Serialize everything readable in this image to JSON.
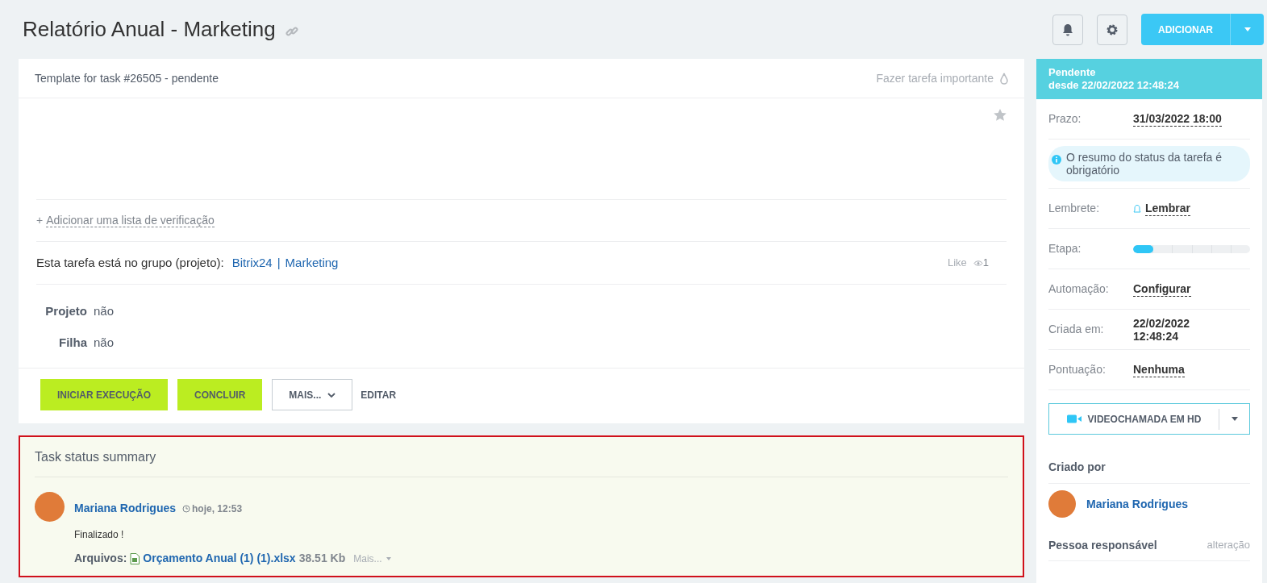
{
  "header": {
    "title": "Relatório Anual - Marketing",
    "add_button": "ADICIONAR"
  },
  "task": {
    "subtitle": "Template for task #26505 - pendente",
    "important_label": "Fazer tarefa importante",
    "checklist_plus": "+",
    "checklist_link": "Adicionar uma lista de verificação",
    "group_label": "Esta tarefa está no grupo (projeto):",
    "group_links": [
      "Bitrix24",
      "Marketing"
    ],
    "group_separator": "|",
    "like": "Like",
    "views": "1",
    "fields": [
      {
        "label": "Projeto",
        "value": "não"
      },
      {
        "label": "Filha",
        "value": "não"
      }
    ],
    "actions": [
      {
        "label": "INICIAR EXECUÇÃO",
        "kind": "primary"
      },
      {
        "label": "CONCLUIR",
        "kind": "primary"
      },
      {
        "label": "MAIS...",
        "kind": "dropdown"
      },
      {
        "label": "EDITAR",
        "kind": "link"
      }
    ]
  },
  "summary": {
    "title": "Task status summary",
    "author": "Mariana Rodrigues",
    "time": "hoje, 12:53",
    "text": "Finalizado !",
    "files_label": "Arquivos:",
    "file_name": "Orçamento Anual (1) (1).xlsx",
    "file_size": "38.51 Kb",
    "more": "Mais..."
  },
  "sidebar": {
    "status": "Pendente",
    "since": "desde 22/02/2022 12:48:24",
    "rows": [
      {
        "kind": "field",
        "label": "Prazo:",
        "value": "31/03/2022 18:00"
      },
      {
        "kind": "notice",
        "text": "O resumo do status da tarefa é obrigatório"
      },
      {
        "kind": "reminder",
        "label": "Lembrete:",
        "value": "Lembrar"
      },
      {
        "kind": "stage",
        "label": "Etapa:",
        "level": 0.17
      },
      {
        "kind": "field",
        "label": "Automação:",
        "value": "Configurar"
      },
      {
        "kind": "plain",
        "label": "Criada em:",
        "value": "22/02/2022 12:48:24"
      },
      {
        "kind": "field",
        "label": "Pontuação:",
        "value": "Nenhuma"
      }
    ],
    "video_button": "VIDEOCHAMADA EM HD",
    "created_by_label": "Criado por",
    "creator": "Mariana Rodrigues",
    "responsible_label": "Pessoa responsável",
    "change_link": "alteração"
  }
}
